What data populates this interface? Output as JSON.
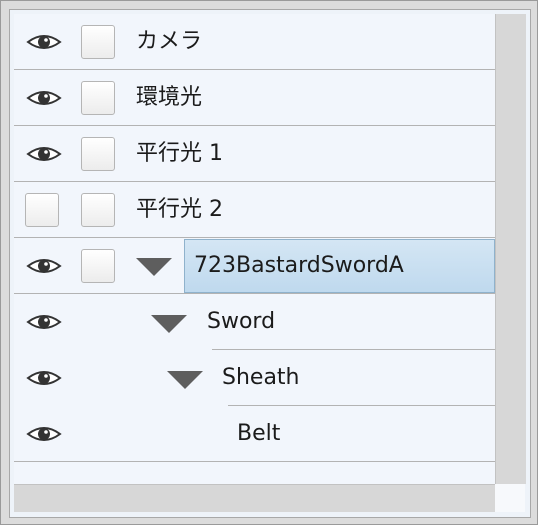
{
  "rows": [
    {
      "label": "カメラ",
      "visible": true,
      "expanded": null
    },
    {
      "label": "環境光",
      "visible": true,
      "expanded": null
    },
    {
      "label": "平行光 1",
      "visible": true,
      "expanded": null
    },
    {
      "label": "平行光 2",
      "visible": false,
      "expanded": null
    },
    {
      "label": "723BastardSwordA",
      "visible": true,
      "expanded": true,
      "selected": true
    },
    {
      "label": "Sword",
      "visible": true,
      "expanded": true
    },
    {
      "label": "Sheath",
      "visible": true,
      "expanded": true
    },
    {
      "label": "Belt",
      "visible": true,
      "expanded": null
    }
  ],
  "icons": {
    "visibility": "eye-icon",
    "expand": "triangle-down-icon"
  },
  "colors": {
    "selection": "#c8e0f2",
    "list_bg": "#f2f6fc"
  }
}
